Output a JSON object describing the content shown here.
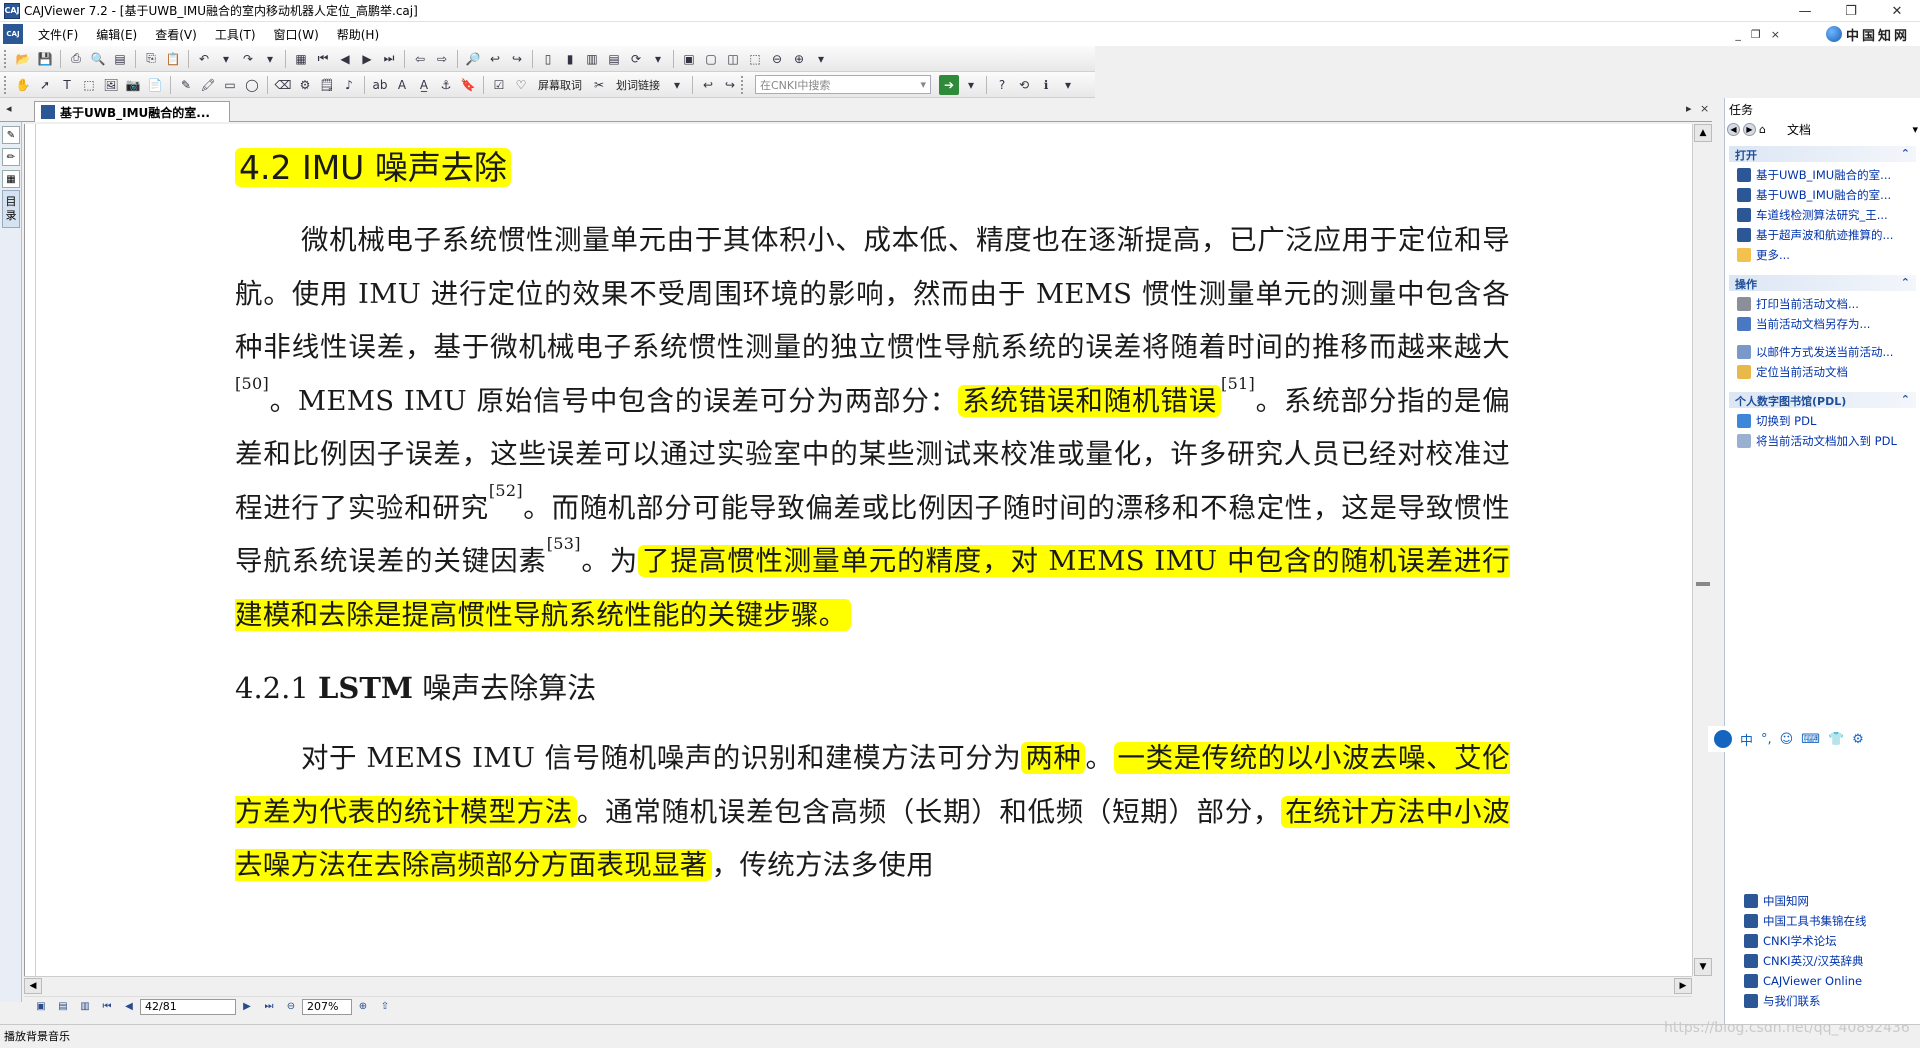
{
  "window": {
    "title": "CAJViewer 7.2 - [基于UWB_IMU融合的室内移动机器人定位_高鹏举.caj]",
    "app_icon_text": "CAJ",
    "min_label": "—",
    "max_label": "❐",
    "close_label": "✕"
  },
  "menu": {
    "items": [
      "文件(F)",
      "编辑(E)",
      "查看(V)",
      "工具(T)",
      "窗口(W)",
      "帮助(H)"
    ],
    "mdi_min": "_",
    "mdi_restore": "❐",
    "mdi_close": "×",
    "brand": "中国知网"
  },
  "toolbar2": {
    "screen_select": "屏幕取词",
    "word_link": "划词链接",
    "search_placeholder": "在CNKI中搜索"
  },
  "tabs": {
    "active": "基于UWB_IMU融合的室...",
    "left_nav": "◂",
    "right_nav": "▸",
    "close": "×"
  },
  "leftbar": {
    "catalog": "目录"
  },
  "document": {
    "heading1": "4.2 IMU 噪声去除",
    "p1": [
      {
        "t": "微机械电子系统惯性测量单元由于其体积小、成本低、精度也在逐渐提高，已广泛应用于定位和导航。使用 IMU 进行定位的效果不受周围环境的影响，然而由于 MEMS 惯性测量单元的测量中包含各种非线性误差，基于微机械电子系统惯性测量的独立惯性导航系统的误差将随着时间的推移而越来越大",
        "h": false
      },
      {
        "sup": "[50]"
      },
      {
        "t": "。MEMS IMU 原始信号中包含的误差可分为两部分：",
        "h": false
      },
      {
        "t": "系统错误和随机错误",
        "h": true
      },
      {
        "sup": "[51]"
      },
      {
        "t": "。系统部分指的是偏差和比例因子误差，这些误差可以通过实验室中的某些测试来校准或量化，许多研究人员已经对校准过程进行了实验和研究",
        "h": false
      },
      {
        "sup": "[52]"
      },
      {
        "t": "。而随机部分可能导致偏差或比例因子随时间的漂移和不稳定性，这是导致惯性导航系统误差的关键因素",
        "h": false
      },
      {
        "sup": "[53]"
      },
      {
        "t": "。为",
        "h": false
      },
      {
        "t": "了提高惯性测量单元的精度，对 MEMS IMU 中包含的随机误差进行建模和去除是提高惯性导航系统性能的关键步骤。",
        "h": true
      }
    ],
    "heading2_num": "4.2.1",
    "heading2_bold": "LSTM",
    "heading2_rest": "噪声去除算法",
    "p2": [
      {
        "t": "对于 MEMS IMU 信号随机噪声的识别和建模方法可分为",
        "h": false
      },
      {
        "t": "两种",
        "h": true
      },
      {
        "t": "。",
        "h": false
      },
      {
        "t": "一类是传统的以小波去噪、艾伦方差为代表的统计模型方法",
        "h": true
      },
      {
        "t": "。通常随机误差包含高频（长期）和低频（短期）部分，",
        "h": false
      },
      {
        "t": "在统计方法中小波去噪方法在去除高频部分方面表现显著",
        "h": true
      },
      {
        "t": "，传统方法多使用",
        "h": false
      }
    ]
  },
  "navbar": {
    "page": "42/81",
    "zoom": "207%"
  },
  "status": {
    "text": "播放背景音乐",
    "watermark": "https://blog.csdn.net/qq_40892436"
  },
  "taskpane": {
    "title": "任务",
    "dropdown": "▾",
    "doc_label": "文档",
    "open_section": "打开",
    "open_items": [
      {
        "label": "基于UWB_IMU融合的室...",
        "icon": "caj-doc-icon"
      },
      {
        "label": "基于UWB_IMU融合的室...",
        "icon": "caj-doc-icon"
      },
      {
        "label": "车道线检测算法研究_王...",
        "icon": "caj-doc-icon"
      },
      {
        "label": "基于超声波和航迹推算的...",
        "icon": "caj-doc-icon"
      },
      {
        "label": "更多...",
        "icon": "folder-icon"
      }
    ],
    "ops_section": "操作",
    "ops_items_a": [
      {
        "label": "打印当前活动文档...",
        "icon": "print-icon"
      },
      {
        "label": "当前活动文档另存为...",
        "icon": "save-icon"
      }
    ],
    "ops_items_b": [
      {
        "label": "以邮件方式发送当前活动...",
        "icon": "mail-icon"
      },
      {
        "label": "定位当前活动文档",
        "icon": "locate-icon"
      }
    ],
    "pdl_section": "个人数字图书馆(PDL)",
    "pdl_items": [
      {
        "label": "切换到 PDL",
        "icon": "switch-icon"
      },
      {
        "label": "将当前活动文档加入到 PDL",
        "icon": "add-doc-icon"
      }
    ],
    "links": [
      "中国知网",
      "中国工具书集锦在线",
      "CNKI学术论坛",
      "CNKI英汉/汉英辞典",
      "CAJViewer Online",
      "与我们联系"
    ]
  },
  "ime": {
    "chinese": "中",
    "items": [
      "°,",
      "☺",
      "⌨",
      "👕",
      "⚙"
    ]
  }
}
